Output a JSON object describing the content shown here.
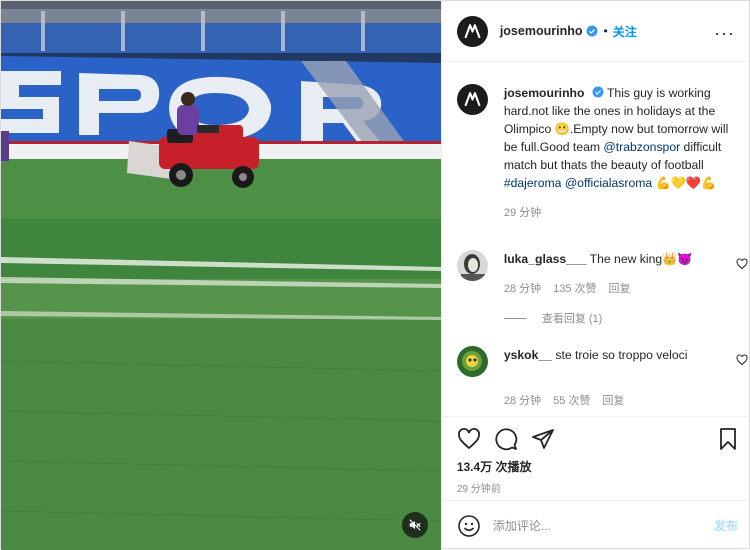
{
  "post": {
    "author": "josemourinho",
    "dot": "•",
    "follow_label": "关注",
    "more_icon": "more-horizontal-icon"
  },
  "caption": {
    "author": "josemourinho",
    "text_1": "This guy is working hard.not like the ones in holidays at the Olimpico",
    "emoji_1": "😬",
    "text_2": ".Empty now but tomorrow will be full.Good team",
    "mention_1": "@trabzonspor",
    "text_3": "difficult match but thats the beauty of football",
    "hashtag": "#dajeroma",
    "mention_2": "@officialasroma",
    "emoji_2": "💪💛❤️💪",
    "time": "29 分钟"
  },
  "comments": [
    {
      "user": "luka_glass___",
      "text": "The new king",
      "emoji": "👑😈",
      "time": "28 分钟",
      "likes": "135 次赞",
      "reply_label": "回复"
    },
    {
      "user": "yskok__",
      "text": "ste troie so troppo veloci",
      "time": "28 分钟",
      "likes": "55 次赞",
      "reply_label": "回复"
    }
  ],
  "view_replies_label": "查看回复 (1)",
  "stats": {
    "likes": "13.4万 次播放",
    "posted": "29 分钟前"
  },
  "composer": {
    "placeholder": "添加评论...",
    "post_label": "发布"
  },
  "colors": {
    "accent": "#0095f6",
    "post_disabled": "#b2dffc",
    "link": "#00376b",
    "muted": "#8e8e8e",
    "stadium_seats": "#2b62c8",
    "pitch": "#3b7f3a",
    "mower": "#c8202a"
  },
  "icons": [
    "verified-icon",
    "heart-icon",
    "comment-icon",
    "share-icon",
    "bookmark-icon",
    "emoji-icon",
    "mute-icon"
  ]
}
